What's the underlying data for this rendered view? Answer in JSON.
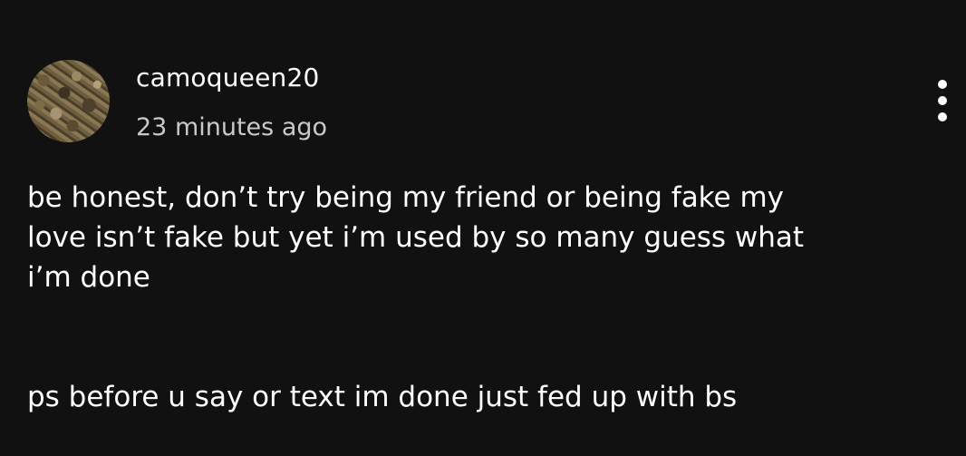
{
  "post": {
    "username": "camoqueen20",
    "timestamp": "23 minutes ago",
    "avatar_icon": "camo-pattern-avatar",
    "more_icon": "more-vertical-icon",
    "lines": [
      "be honest, don’t try being my friend or being fake my",
      "love isn’t fake but yet i’m used by so many guess what",
      "i’m done",
      "ps before u say or text im done just fed up with bs"
    ]
  },
  "colors": {
    "background": "#111111",
    "text": "#ffffff",
    "muted": "#c9c9c9"
  }
}
